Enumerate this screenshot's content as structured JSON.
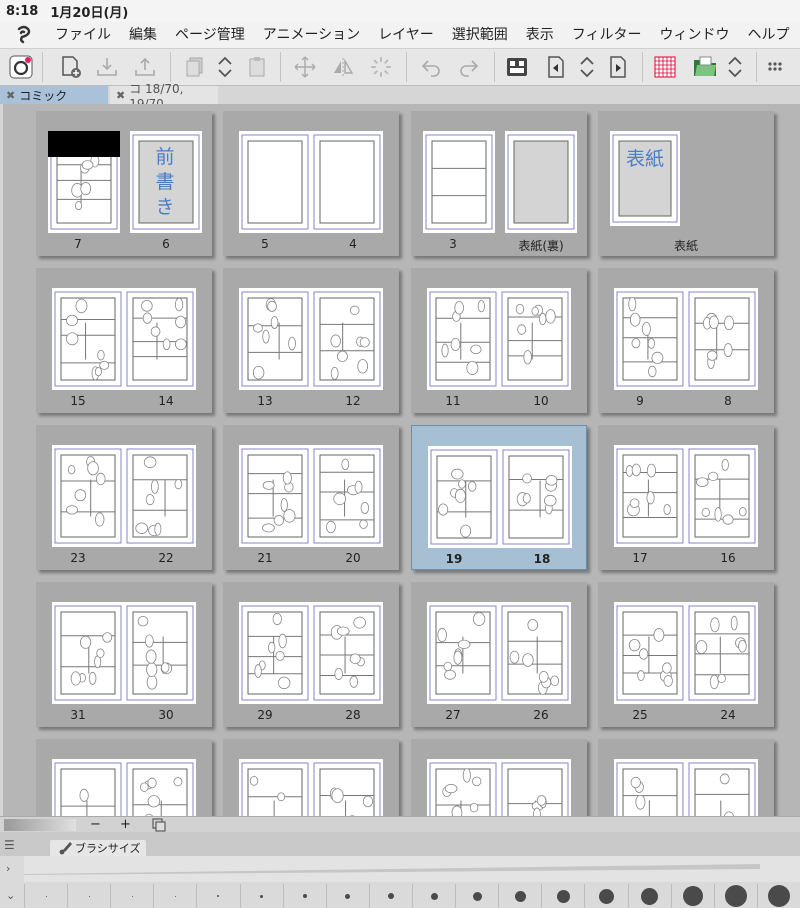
{
  "status": {
    "time": "8:18",
    "date": "1月20日(月)"
  },
  "menu": [
    "ファイル",
    "編集",
    "ページ管理",
    "アニメーション",
    "レイヤー",
    "選択範囲",
    "表示",
    "フィルター",
    "ウィンドウ",
    "ヘルプ"
  ],
  "tabs": [
    {
      "label": "コミック",
      "active": true
    },
    {
      "label": "コ 18/70, 19/70",
      "active": false
    }
  ],
  "spreads": [
    {
      "left": "7",
      "right": "6",
      "selected": false,
      "kind": "cover-front"
    },
    {
      "left": "5",
      "right": "4",
      "selected": false,
      "kind": "blank"
    },
    {
      "left": "3",
      "right": "表紙(裏)",
      "selected": false,
      "kind": "inner-cover"
    },
    {
      "left": "",
      "right": "表紙",
      "selected": false,
      "kind": "cover"
    },
    {
      "left": "15",
      "right": "14",
      "selected": false,
      "kind": "manga"
    },
    {
      "left": "13",
      "right": "12",
      "selected": false,
      "kind": "manga"
    },
    {
      "left": "11",
      "right": "10",
      "selected": false,
      "kind": "manga"
    },
    {
      "left": "9",
      "right": "8",
      "selected": false,
      "kind": "manga"
    },
    {
      "left": "23",
      "right": "22",
      "selected": false,
      "kind": "manga"
    },
    {
      "left": "21",
      "right": "20",
      "selected": false,
      "kind": "manga"
    },
    {
      "left": "19",
      "right": "18",
      "selected": true,
      "kind": "manga"
    },
    {
      "left": "17",
      "right": "16",
      "selected": false,
      "kind": "manga"
    },
    {
      "left": "31",
      "right": "30",
      "selected": false,
      "kind": "manga"
    },
    {
      "left": "29",
      "right": "28",
      "selected": false,
      "kind": "manga"
    },
    {
      "left": "27",
      "right": "26",
      "selected": false,
      "kind": "manga"
    },
    {
      "left": "25",
      "right": "24",
      "selected": false,
      "kind": "manga"
    },
    {
      "left": "",
      "right": "",
      "selected": false,
      "kind": "partial"
    },
    {
      "left": "",
      "right": "",
      "selected": false,
      "kind": "partial"
    },
    {
      "left": "",
      "right": "",
      "selected": false,
      "kind": "partial"
    },
    {
      "left": "",
      "right": "",
      "selected": false,
      "kind": "partial"
    }
  ],
  "cover_text": {
    "preface": "前書き",
    "cover": "表紙"
  },
  "zoom": {
    "minus": "−",
    "plus": "+"
  },
  "palette": {
    "title": "ブラシサイズ",
    "size_count": 18
  },
  "toolbar_icons": [
    "clip-studio-logo",
    "new-page-icon",
    "import-icon",
    "export-icon",
    "duplicate-page-icon",
    "page-up-down-icon",
    "paste-page-icon",
    "move-icon",
    "flip-icon",
    "loading-icon",
    "undo-icon",
    "redo-icon",
    "page-layout-icon",
    "prev-page-icon",
    "page-nav-icon",
    "next-page-icon",
    "grid-icon",
    "open-folder-icon",
    "folder-nav-icon",
    "more-icon"
  ],
  "colors": {
    "accent": "#a9c2da",
    "ink": "#4b7dc9",
    "background": "#b6b6b6"
  }
}
